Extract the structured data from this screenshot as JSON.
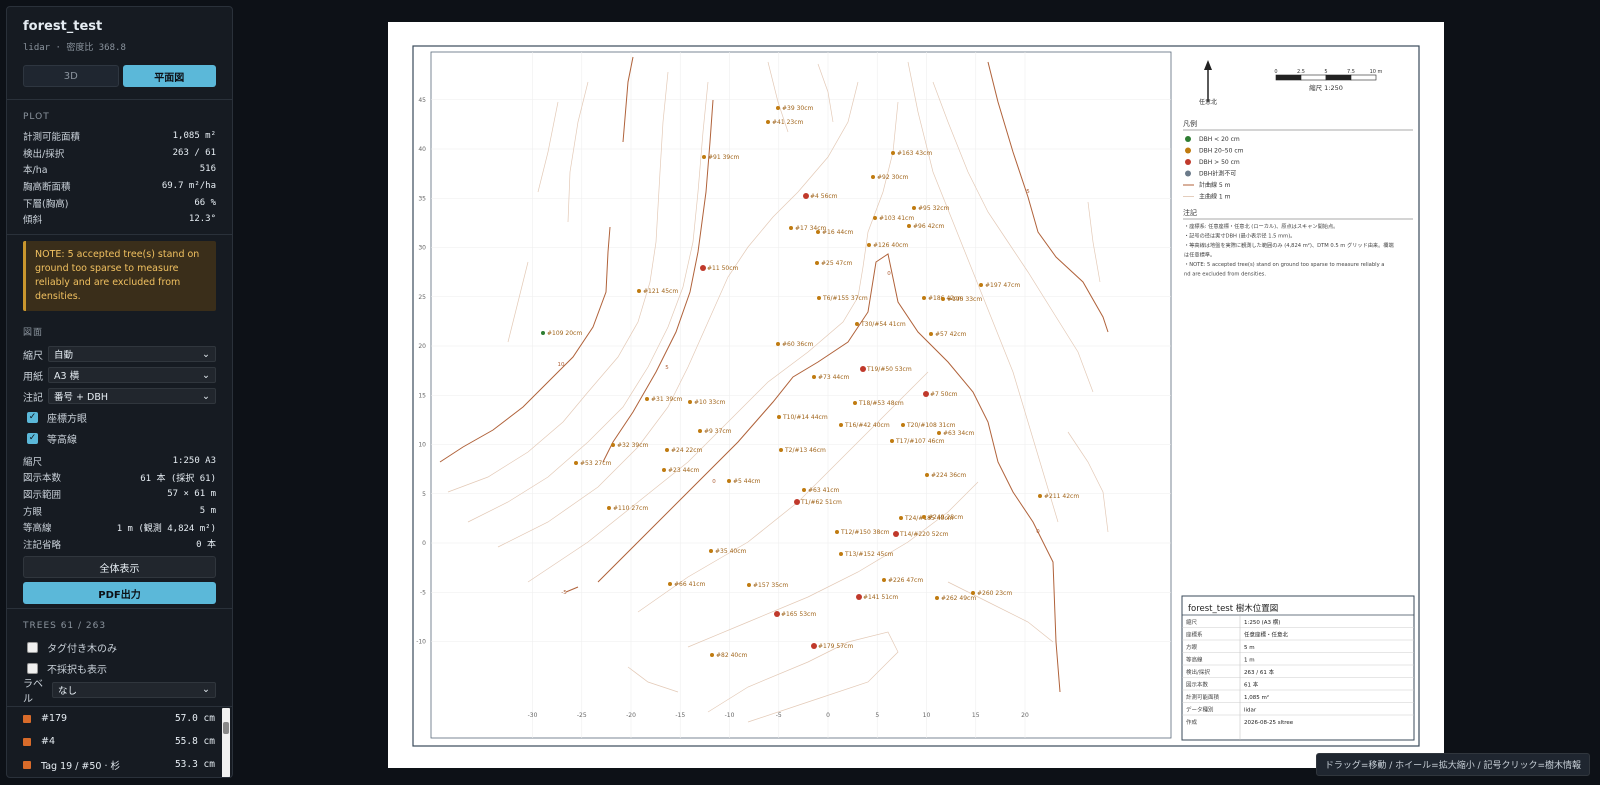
{
  "app": {
    "title": "forest_test",
    "subtitle": "lidar · 密度比 368.8"
  },
  "view": {
    "btn_3d": "3D",
    "btn_plan": "平面図"
  },
  "plot": {
    "section": "PLOT",
    "rows": [
      {
        "k": "計測可能面積",
        "v": "1,085 m²"
      },
      {
        "k": "検出/採択",
        "v": "263 / 61"
      },
      {
        "k": "本/ha",
        "v": "516"
      },
      {
        "k": "胸高断面積",
        "v": "69.7 m²/ha"
      },
      {
        "k": "下層(胸高)",
        "v": "66 %"
      },
      {
        "k": "傾斜",
        "v": "12.3°"
      }
    ],
    "note": "NOTE: 5 accepted tree(s) stand on ground too sparse to measure reliably and are excluded from densities."
  },
  "drawing": {
    "section": "図面",
    "scale": {
      "label": "縮尺",
      "value": "自動"
    },
    "paper": {
      "label": "用紙",
      "value": "A3 横"
    },
    "annot": {
      "label": "注記",
      "value": "番号 + DBH"
    },
    "grid_chk": "座標方眼",
    "contour_chk": "等高線",
    "rows": [
      {
        "k": "縮尺",
        "v": "1:250  A3"
      },
      {
        "k": "図示本数",
        "v": "61 本 (採択 61)"
      },
      {
        "k": "図示範囲",
        "v": "57 × 61 m"
      },
      {
        "k": "方眼",
        "v": "5 m"
      },
      {
        "k": "等高線",
        "v": "1 m (観測 4,824 m²)"
      },
      {
        "k": "注記省略",
        "v": "0 本"
      }
    ],
    "fit_btn": "全体表示",
    "pdf_btn": "PDF出力"
  },
  "trees": {
    "section": "TREES 61 / 263",
    "tagged_only": "タグ付き木のみ",
    "show_rejected": "不採択も表示",
    "label": {
      "label": "ラベル",
      "value": "なし"
    },
    "items": [
      {
        "name": "#179",
        "dbh": "57.0 cm"
      },
      {
        "name": "#4",
        "dbh": "55.8 cm"
      },
      {
        "name": "Tag 19 / #50 · 杉",
        "dbh": "53.3 cm"
      }
    ]
  },
  "map": {
    "north": "任意北",
    "scale_ticks": [
      "0",
      "2.5",
      "5",
      "7.5",
      "10 m"
    ],
    "scale_label": "縮尺 1:250",
    "legend_title": "凡例",
    "legend": [
      {
        "text": "DBH < 20 cm",
        "color": "#2e7d32"
      },
      {
        "text": "DBH 20–50 cm",
        "color": "#c07b10"
      },
      {
        "text": "DBH > 50 cm",
        "color": "#c0392b"
      },
      {
        "text": "DBH計測不可",
        "color": "#6b7a8a"
      },
      {
        "text": "計曲線 5 m",
        "color": "#b0623a"
      },
      {
        "text": "主曲線 1 m",
        "color": "#d9b8a0"
      }
    ],
    "notes_title": "注記",
    "notes": [
      "・座標系: 任意座標・任意北 (ローカル)、原点はスキャン開始点。",
      "・記号の径は実寸DBH (最小表示径 1.5 mm)。",
      "・等高線は地盤を実際に観測した範囲のみ (4,824 m²)、DTM 0.5 m グリッド由来。欄端",
      "  は任意標準。",
      "・NOTE: 5 accepted tree(s) stand on ground too sparse to measure reliably a",
      "  nd are excluded from densities."
    ],
    "xticks": [
      "-30",
      "-25",
      "-20",
      "-15",
      "-10",
      "-5",
      "0",
      "5",
      "10",
      "15",
      "20"
    ],
    "yticks": [
      "45",
      "40",
      "35",
      "30",
      "25",
      "20",
      "15",
      "10",
      "5",
      "0",
      "-5",
      "-10"
    ],
    "contour_labels": [
      "10",
      "5",
      "0",
      "-5",
      "0",
      "5",
      "0"
    ],
    "tree_labels": [
      {
        "t": "#39 30cm",
        "c": "m"
      },
      {
        "t": "#41 23cm",
        "c": "m"
      },
      {
        "t": "#91 39cm",
        "c": "m"
      },
      {
        "t": "#163 43cm",
        "c": "m"
      },
      {
        "t": "#92 30cm",
        "c": "m"
      },
      {
        "t": "#4 56cm",
        "c": "l"
      },
      {
        "t": "#95 32cm",
        "c": "m"
      },
      {
        "t": "#103 41cm",
        "c": "m"
      },
      {
        "t": "#17 34cm",
        "c": "m"
      },
      {
        "t": "#16 44cm",
        "c": "m"
      },
      {
        "t": "#96 42cm",
        "c": "m"
      },
      {
        "t": "#126 40cm",
        "c": "m"
      },
      {
        "t": "#11 50cm",
        "c": "l"
      },
      {
        "t": "#25 47cm",
        "c": "m"
      },
      {
        "t": "#197 47cm",
        "c": "m"
      },
      {
        "t": "#121 45cm",
        "c": "m"
      },
      {
        "t": "T6/#155 37cm",
        "c": "m"
      },
      {
        "t": "#186 42cm",
        "c": "m"
      },
      {
        "t": "#195 33cm",
        "c": "m"
      },
      {
        "t": "T30/#54 41cm",
        "c": "m"
      },
      {
        "t": "#57 42cm",
        "c": "m"
      },
      {
        "t": "#109 20cm",
        "c": "s"
      },
      {
        "t": "#60 36cm",
        "c": "m"
      },
      {
        "t": "T19/#50 53cm",
        "c": "l"
      },
      {
        "t": "#73 44cm",
        "c": "m"
      },
      {
        "t": "#7 50cm",
        "c": "l"
      },
      {
        "t": "#31 39cm",
        "c": "m"
      },
      {
        "t": "#10 33cm",
        "c": "m"
      },
      {
        "t": "T18/#53 48cm",
        "c": "m"
      },
      {
        "t": "T10/#14 44cm",
        "c": "m"
      },
      {
        "t": "T20/#108 31cm",
        "c": "m"
      },
      {
        "t": "#9 37cm",
        "c": "m"
      },
      {
        "t": "T16/#42 40cm",
        "c": "m"
      },
      {
        "t": "#63 34cm",
        "c": "m"
      },
      {
        "t": "T17/#107 46cm",
        "c": "m"
      },
      {
        "t": "#32 39cm",
        "c": "m"
      },
      {
        "t": "#24 22cm",
        "c": "m"
      },
      {
        "t": "T2/#13 46cm",
        "c": "m"
      },
      {
        "t": "#53 27cm",
        "c": "m"
      },
      {
        "t": "#23 44cm",
        "c": "m"
      },
      {
        "t": "#224 36cm",
        "c": "m"
      },
      {
        "t": "#5 44cm",
        "c": "m"
      },
      {
        "t": "#63 41cm",
        "c": "m"
      },
      {
        "t": "#211 42cm",
        "c": "m"
      },
      {
        "t": "T1/#62 51cm",
        "c": "l"
      },
      {
        "t": "#110 27cm",
        "c": "m"
      },
      {
        "t": "T24/#185 40cm",
        "c": "m"
      },
      {
        "t": "#249 28cm",
        "c": "m"
      },
      {
        "t": "T12/#150 38cm",
        "c": "m"
      },
      {
        "t": "T14/#220 52cm",
        "c": "l"
      },
      {
        "t": "#35 40cm",
        "c": "m"
      },
      {
        "t": "T13/#152 45cm",
        "c": "m"
      },
      {
        "t": "#66 41cm",
        "c": "m"
      },
      {
        "t": "#157 35cm",
        "c": "m"
      },
      {
        "t": "#226 47cm",
        "c": "m"
      },
      {
        "t": "#141 51cm",
        "c": "l"
      },
      {
        "t": "#262 49cm",
        "c": "m"
      },
      {
        "t": "#260 23cm",
        "c": "m"
      },
      {
        "t": "#165 53cm",
        "c": "l"
      },
      {
        "t": "#179 57cm",
        "c": "l"
      },
      {
        "t": "#82 40cm",
        "c": "m"
      }
    ],
    "title_block": {
      "title": "forest_test 樹木位置図",
      "rows": [
        {
          "k": "縮尺",
          "v": "1:250 (A3 横)"
        },
        {
          "k": "座標系",
          "v": "任意座標・任意北"
        },
        {
          "k": "方眼",
          "v": "5 m"
        },
        {
          "k": "等高線",
          "v": "1 m"
        },
        {
          "k": "検出/採択",
          "v": "263 / 61 本"
        },
        {
          "k": "図示本数",
          "v": "61 本"
        },
        {
          "k": "計測可能面積",
          "v": "1,085 m²"
        },
        {
          "k": "データ種別",
          "v": "lidar"
        },
        {
          "k": "作成",
          "v": "2026-08-25 sltree"
        }
      ]
    }
  },
  "hint": "ドラッグ=移動 / ホイール=拡大縮小 / 記号クリック=樹木情報"
}
